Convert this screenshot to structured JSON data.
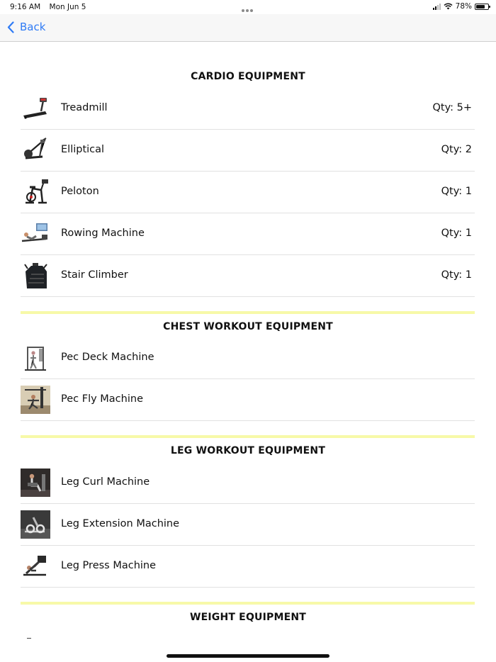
{
  "status": {
    "time": "9:16 AM",
    "date": "Mon Jun 5",
    "battery": "78%",
    "battery_level": 0.78
  },
  "nav": {
    "back_label": "Back"
  },
  "sections": [
    {
      "title": "CARDIO EQUIPMENT",
      "items": [
        {
          "name": "Treadmill",
          "qty": "Qty: 5+",
          "icon": "treadmill-icon"
        },
        {
          "name": "Elliptical",
          "qty": "Qty: 2",
          "icon": "elliptical-icon"
        },
        {
          "name": "Peloton",
          "qty": "Qty: 1",
          "icon": "peloton-icon"
        },
        {
          "name": "Rowing Machine",
          "qty": "Qty: 1",
          "icon": "rowing-machine-icon"
        },
        {
          "name": "Stair Climber",
          "qty": "Qty: 1",
          "icon": "stair-climber-icon"
        }
      ]
    },
    {
      "title": "CHEST WORKOUT EQUIPMENT",
      "items": [
        {
          "name": "Pec Deck Machine",
          "icon": "pec-deck-icon"
        },
        {
          "name": "Pec Fly Machine",
          "icon": "pec-fly-icon"
        }
      ]
    },
    {
      "title": "LEG WORKOUT EQUIPMENT",
      "items": [
        {
          "name": "Leg Curl Machine",
          "icon": "leg-curl-icon"
        },
        {
          "name": "Leg Extension Machine",
          "icon": "leg-extension-icon"
        },
        {
          "name": "Leg Press Machine",
          "icon": "leg-press-icon"
        }
      ]
    },
    {
      "title": "WEIGHT EQUIPMENT",
      "items": []
    }
  ],
  "colors": {
    "accent": "#2f7bf5",
    "section_divider": "#f7f9a8",
    "row_divider": "#e1e1e1"
  }
}
